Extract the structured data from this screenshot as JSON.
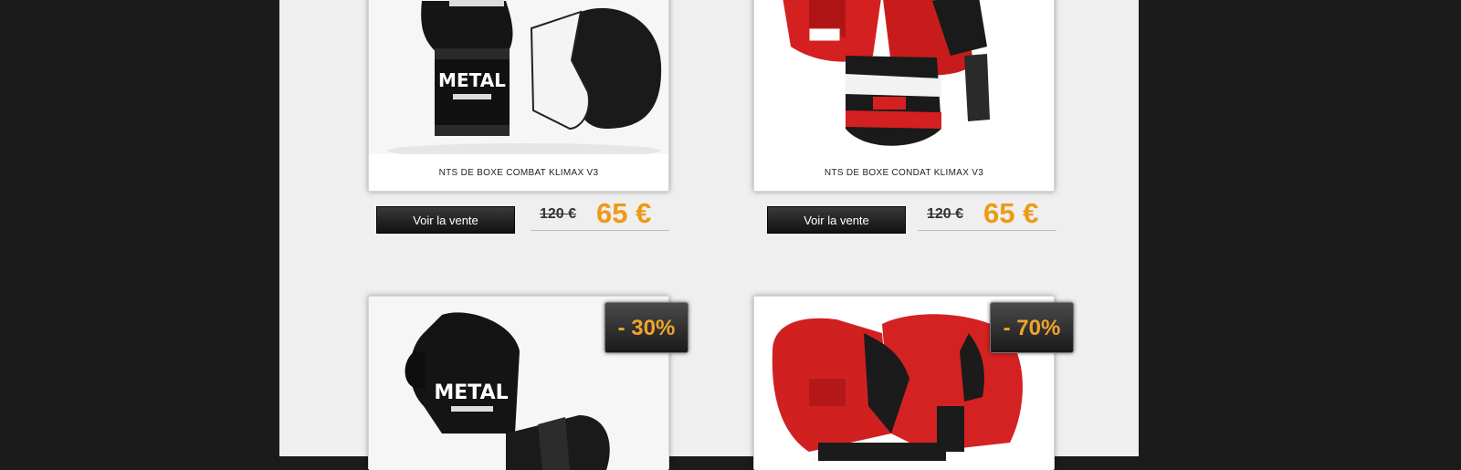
{
  "colors": {
    "background": "#1b1b1b",
    "page": "#efefef",
    "price_accent": "#ee9a16",
    "button": "#222222",
    "glove_black": "#111111",
    "glove_red": "#d32222"
  },
  "products": [
    {
      "title": "NTS DE BOXE COMBAT KLIMAX V3",
      "button_label": "Voir la vente",
      "old_price": "120 €",
      "new_price": "65 €",
      "image_icon": "black-boxing-gloves-image",
      "brand_mark": "METAL"
    },
    {
      "title": "NTS DE BOXE CONDAT KLIMAX V3",
      "button_label": "Voir la vente",
      "old_price": "120 €",
      "new_price": "65 €",
      "image_icon": "red-boxing-gloves-image"
    },
    {
      "discount": "- 30%",
      "image_icon": "black-boxing-gloves-image",
      "brand_mark": "METAL"
    },
    {
      "discount": "- 70%",
      "image_icon": "red-boxing-gloves-image"
    }
  ]
}
